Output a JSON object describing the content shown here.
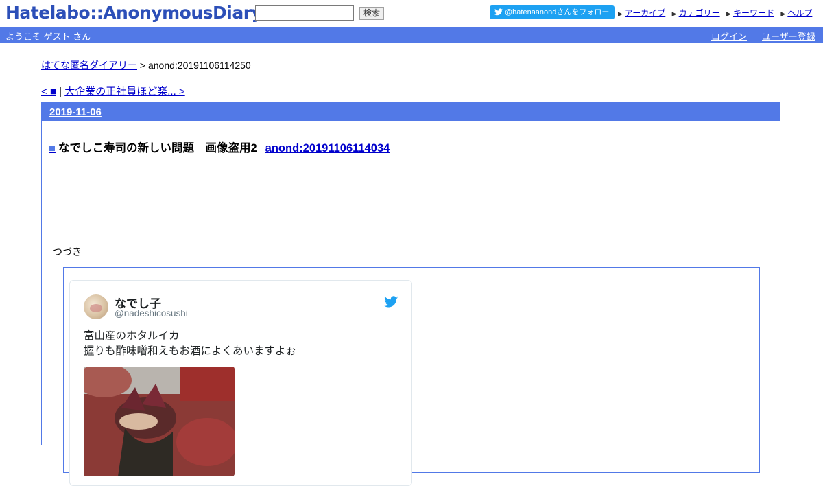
{
  "header": {
    "logo": "Hatelabo::AnonymousDiary",
    "search_button": "検索",
    "search_value": "",
    "follow_button": "@hatenaanondさんをフォロー",
    "links": [
      "アーカイブ",
      "カテゴリー",
      "キーワード",
      "ヘルプ"
    ]
  },
  "welcome_bar": {
    "text": "ようこそ ゲスト さん",
    "login": "ログイン",
    "register": "ユーザー登録"
  },
  "breadcrumb": {
    "home": "はてな匿名ダイアリー",
    "separator": " > ",
    "current": "anond:20191106114250"
  },
  "pager": {
    "prev": "< ■",
    "divider": " | ",
    "next": "大企業の正社員ほど楽... >"
  },
  "day": {
    "date": "2019-11-06",
    "entry": {
      "square": "■",
      "title": "なでしこ寿司の新しい問題　画像盗用2",
      "anchor": "anond:20191106114034",
      "body": "つづき"
    }
  },
  "tweet": {
    "name": "なでし子",
    "handle": "@nadeshicosushi",
    "line1": "富山産のホタルイカ",
    "line2": "握りも酢味噌和えもお酒によくあいますよぉ"
  },
  "colors": {
    "accent": "#5279e7",
    "logo": "#2c4fb8",
    "twitter": "#1da1f2",
    "link": "#0000cc"
  }
}
